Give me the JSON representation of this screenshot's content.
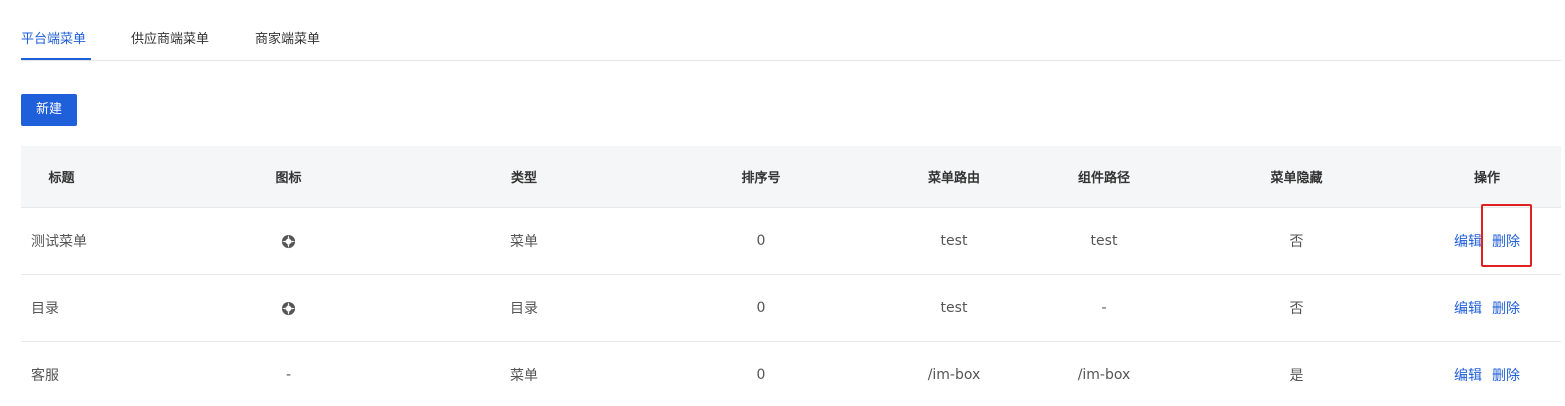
{
  "tabs": [
    {
      "label": "平台端菜单",
      "active": true
    },
    {
      "label": "供应商端菜单",
      "active": false
    },
    {
      "label": "商家端菜单",
      "active": false
    }
  ],
  "toolbar": {
    "new_label": "新建"
  },
  "table": {
    "headers": [
      "标题",
      "图标",
      "类型",
      "排序号",
      "菜单路由",
      "组件路径",
      "菜单隐藏",
      "操作"
    ],
    "rows": [
      {
        "title": "测试菜单",
        "icon": "aperture-icon",
        "type": "菜单",
        "order": "0",
        "route": "test",
        "component": "test",
        "hidden": "否",
        "edit": "编辑",
        "delete": "删除"
      },
      {
        "title": "目录",
        "icon": "aperture-icon",
        "type": "目录",
        "order": "0",
        "route": "test",
        "component": "-",
        "hidden": "否",
        "edit": "编辑",
        "delete": "删除"
      },
      {
        "title": "客服",
        "icon": "-",
        "type": "菜单",
        "order": "0",
        "route": "/im-box",
        "component": "/im-box",
        "hidden": "是",
        "edit": "编辑",
        "delete": "删除"
      }
    ]
  },
  "colors": {
    "accent": "#1f5fd9",
    "header_bg": "#f5f6f7",
    "highlight": "#e02020"
  }
}
